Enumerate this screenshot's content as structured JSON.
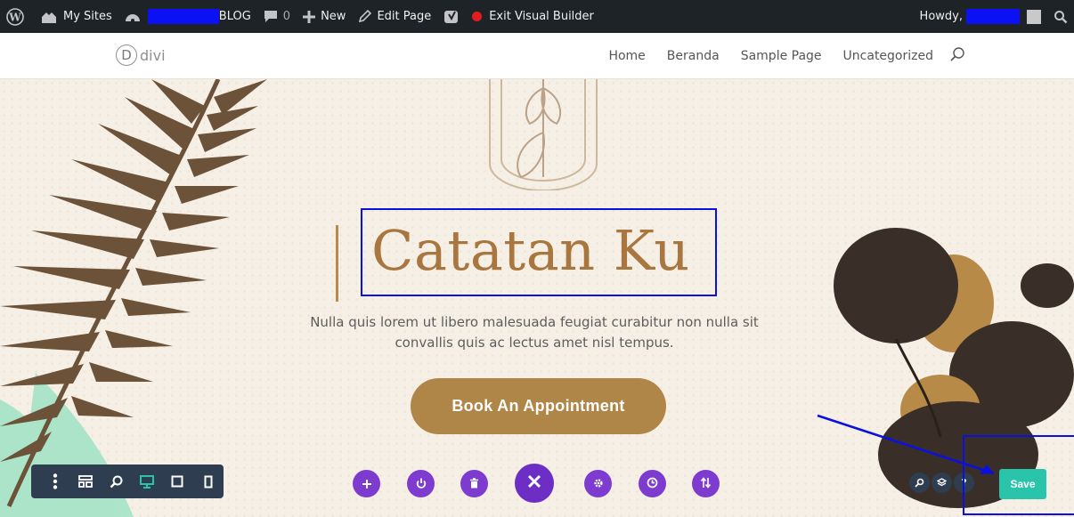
{
  "admin_bar": {
    "my_sites": "My Sites",
    "site_name": "BLOG",
    "comments": "0",
    "new": "New",
    "edit_page": "Edit Page",
    "exit_builder": "Exit Visual Builder",
    "howdy": "Howdy,"
  },
  "site": {
    "logo_letter": "D",
    "logo_text": "divi",
    "nav": [
      "Home",
      "Beranda",
      "Sample Page",
      "Uncategorized"
    ]
  },
  "hero": {
    "title": "Catatan Ku",
    "subtitle_line1": "Nulla quis lorem ut libero malesuada feugiat curabitur non nulla sit",
    "subtitle_line2": "convallis quis ac lectus amet nisl tempus.",
    "cta": "Book An Appointment"
  },
  "divi": {
    "save": "Save",
    "help": "?"
  },
  "colors": {
    "admin_bg": "#1d2327",
    "accent_brown": "#b08548",
    "divi_purple": "#7e3bd0",
    "divi_dark": "#2e3d4f",
    "save_green": "#29c4a9",
    "annotation_blue": "#0b10e0"
  },
  "icons": {
    "wordpress": "wordpress-icon",
    "sites": "house-icon",
    "dashboard": "gauge-icon",
    "comment": "comment-bubble-icon",
    "new": "plus-icon",
    "edit": "pencil-icon",
    "yoast": "yoast-icon",
    "search": "search-icon"
  }
}
